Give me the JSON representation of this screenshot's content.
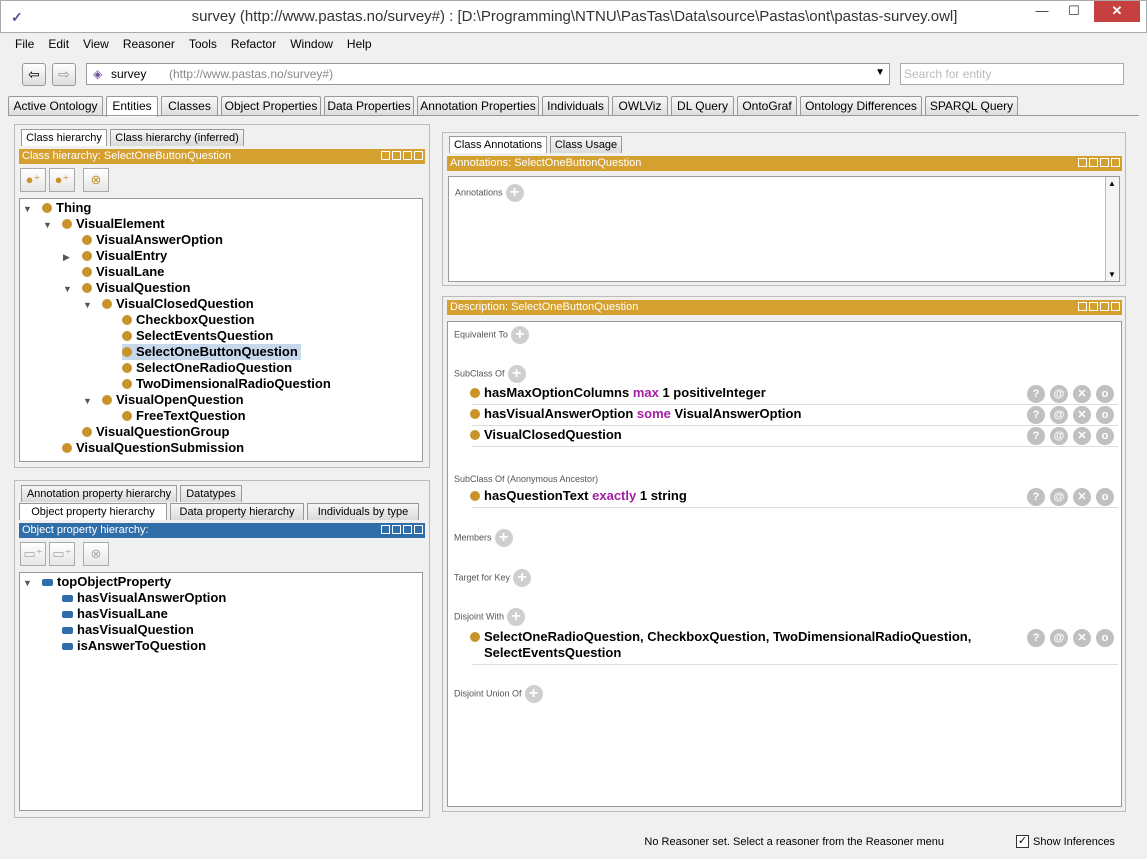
{
  "window": {
    "title": "survey (http://www.pastas.no/survey#)  : [D:\\Programming\\NTNU\\PasTas\\Data\\source\\Pastas\\ont\\pastas-survey.owl]"
  },
  "menu": [
    "File",
    "Edit",
    "View",
    "Reasoner",
    "Tools",
    "Refactor",
    "Window",
    "Help"
  ],
  "nav": {
    "ontology_name": "survey",
    "ontology_iri": "(http://www.pastas.no/survey#)",
    "search_placeholder": "Search for entity"
  },
  "tabs": [
    "Active Ontology",
    "Entities",
    "Classes",
    "Object Properties",
    "Data Properties",
    "Annotation Properties",
    "Individuals",
    "OWLViz",
    "DL Query",
    "OntoGraf",
    "Ontology Differences",
    "SPARQL Query"
  ],
  "active_tab": "Entities",
  "class_panel": {
    "tabs": [
      "Class hierarchy",
      "Class hierarchy (inferred)"
    ],
    "header": "Class hierarchy: SelectOneButtonQuestion",
    "nodes": [
      "Thing",
      "VisualElement",
      "VisualAnswerOption",
      "VisualEntry",
      "VisualLane",
      "VisualQuestion",
      "VisualClosedQuestion",
      "CheckboxQuestion",
      "SelectEventsQuestion",
      "SelectOneButtonQuestion",
      "SelectOneRadioQuestion",
      "TwoDimensionalRadioQuestion",
      "VisualOpenQuestion",
      "FreeTextQuestion",
      "VisualQuestionGroup",
      "VisualQuestionSubmission"
    ],
    "selected": "SelectOneButtonQuestion"
  },
  "property_panel": {
    "tabs_top": [
      "Annotation property hierarchy",
      "Datatypes"
    ],
    "tabs_bottom": [
      "Object property hierarchy",
      "Data property hierarchy",
      "Individuals by type"
    ],
    "header": "Object property hierarchy:",
    "nodes": [
      "topObjectProperty",
      "hasVisualAnswerOption",
      "hasVisualLane",
      "hasVisualQuestion",
      "isAnswerToQuestion"
    ]
  },
  "annotations_panel": {
    "tabs": [
      "Class Annotations",
      "Class Usage"
    ],
    "header": "Annotations: SelectOneButtonQuestion",
    "label": "Annotations"
  },
  "description_panel": {
    "header": "Description: SelectOneButtonQuestion",
    "sections": {
      "equivalent": "Equivalent To",
      "subclass": "SubClass Of",
      "anon": "SubClass Of (Anonymous Ancestor)",
      "members": "Members",
      "target": "Target for Key",
      "disjoint": "Disjoint With",
      "disjoint_union": "Disjoint Union Of"
    },
    "subclass_axioms": [
      {
        "subject": "hasMaxOptionColumns",
        "keyword": "max",
        "object": "1 positiveInteger"
      },
      {
        "subject": "hasVisualAnswerOption",
        "keyword": "some",
        "object": "VisualAnswerOption"
      },
      {
        "subject": "VisualClosedQuestion",
        "keyword": "",
        "object": ""
      }
    ],
    "anon_axiom": {
      "subject": "hasQuestionText",
      "keyword": "exactly",
      "object": "1 string"
    },
    "disjoint_line1": "SelectOneRadioQuestion, CheckboxQuestion, TwoDimensionalRadioQuestion,",
    "disjoint_line2": "SelectEventsQuestion"
  },
  "status": {
    "text": "No Reasoner set. Select a reasoner from the Reasoner menu",
    "show_inferences": "Show Inferences",
    "show_inferences_checked": true
  },
  "colors": {
    "class_accent": "#d4a030",
    "property_accent": "#2f6ea8",
    "keyword": "#a41ea4"
  }
}
